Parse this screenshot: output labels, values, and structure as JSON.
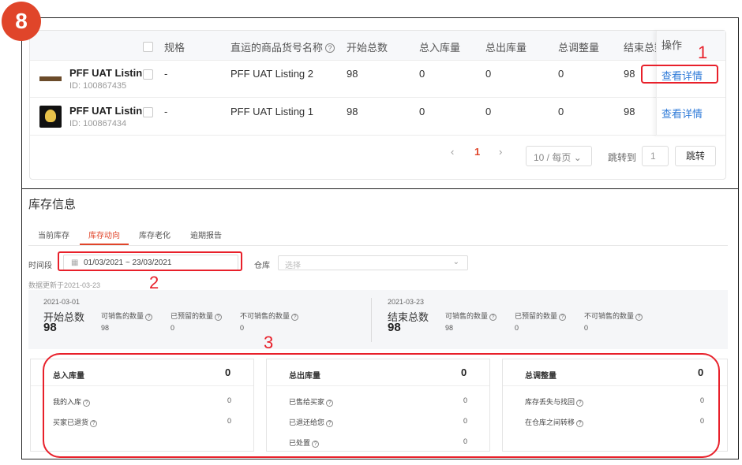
{
  "step_badge": "8",
  "table": {
    "headers": {
      "spec": "规格",
      "listing_name": "直运的商品货号名称",
      "start_total": "开始总数",
      "total_in": "总入库量",
      "total_out": "总出库量",
      "total_adjust": "总调整量",
      "end_total": "结束总数",
      "action": "操作"
    },
    "rows": [
      {
        "name": "PFF UAT Listin...",
        "id": "ID: 100867435",
        "spec": "-",
        "listing": "PFF UAT Listing 2",
        "start": "98",
        "in": "0",
        "out": "0",
        "adjust": "0",
        "end": "98",
        "action": "查看详情"
      },
      {
        "name": "PFF UAT Listin...",
        "id": "ID: 100867434",
        "spec": "-",
        "listing": "PFF UAT Listing 1",
        "start": "98",
        "in": "0",
        "out": "0",
        "adjust": "0",
        "end": "98",
        "action": "查看详情"
      }
    ],
    "pagination": {
      "prev": "‹",
      "current": "1",
      "next": "›",
      "page_size": "10 / 每页",
      "jump_label": "跳转到",
      "jump_value": "1",
      "jump_button": "跳转"
    }
  },
  "inventory": {
    "title": "库存信息",
    "tabs": [
      "当前库存",
      "库存动向",
      "库存老化",
      "逾期报告"
    ],
    "period_label": "时间段",
    "date_range": "01/03/2021 ~ 23/03/2021",
    "warehouse_label": "仓库",
    "warehouse_placeholder": "选择",
    "updated": "数据更新于2021-03-23",
    "start": {
      "date": "2021-03-01",
      "label": "开始总数",
      "value": "98",
      "sellable_label": "可销售的数量",
      "sellable_value": "98",
      "reserved_label": "已预留的数量",
      "reserved_value": "0",
      "unsellable_label": "不可销售的数量",
      "unsellable_value": "0"
    },
    "end": {
      "date": "2021-03-23",
      "label": "结束总数",
      "value": "98",
      "sellable_label": "可销售的数量",
      "sellable_value": "98",
      "reserved_label": "已预留的数量",
      "reserved_value": "0",
      "unsellable_label": "不可销售的数量",
      "unsellable_value": "0"
    },
    "cards": {
      "in": {
        "title": "总入库量",
        "total": "0",
        "rows": [
          {
            "label": "我的入库",
            "value": "0"
          },
          {
            "label": "买家已退货",
            "value": "0"
          }
        ]
      },
      "out": {
        "title": "总出库量",
        "total": "0",
        "rows": [
          {
            "label": "已售给买家",
            "value": "0"
          },
          {
            "label": "已退还给您",
            "value": "0"
          },
          {
            "label": "已处置",
            "value": "0"
          }
        ]
      },
      "adjust": {
        "title": "总调整量",
        "total": "0",
        "rows": [
          {
            "label": "库存丢失与找回",
            "value": "0"
          },
          {
            "label": "在仓库之间转移",
            "value": "0"
          }
        ]
      }
    }
  },
  "annotations": {
    "one": "1",
    "two": "2",
    "three": "3"
  },
  "colors": {
    "accent": "#e0452a",
    "link": "#2f7bd8",
    "annotation": "#e8202a"
  }
}
